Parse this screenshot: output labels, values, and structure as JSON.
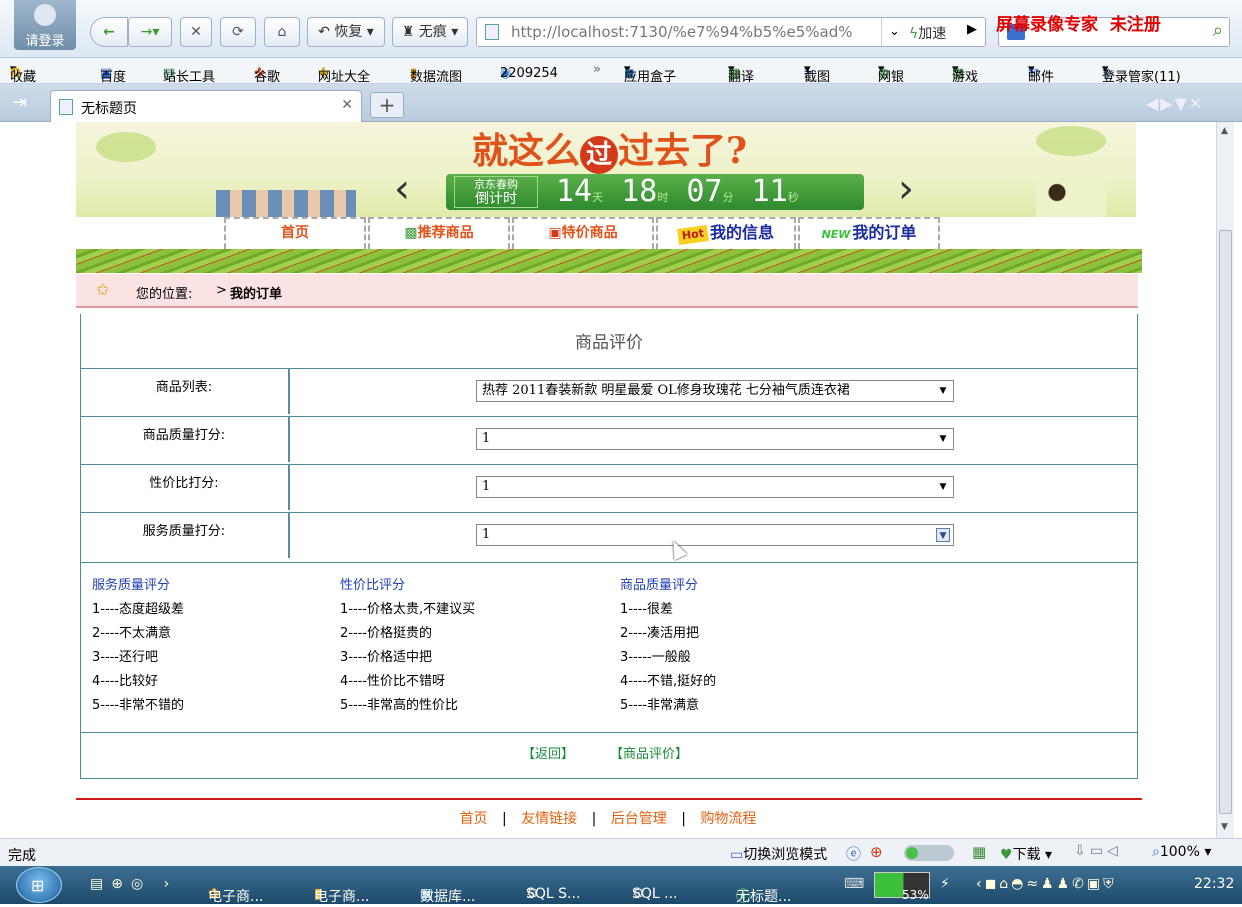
{
  "browser": {
    "login_label": "请登录",
    "restore_label": "恢复",
    "incognito_label": "无痕",
    "url": "http://localhost:7130/%e7%94%b5%e5%ad%",
    "accelerate_label": "加速",
    "watermark": "屏幕录像专家  未注册"
  },
  "bookmarks": [
    "收藏",
    "百度",
    "站长工具",
    "谷歌",
    "网址大全",
    "数据流图",
    "2209254",
    "应用盒子",
    "翻译",
    "截图",
    "网银",
    "游戏",
    "邮件",
    "登录管家(11)"
  ],
  "tab": {
    "title": "无标题页"
  },
  "banner": {
    "slogan": "就这么",
    "slogan_circle": "过",
    "slogan_tail": "过去了?",
    "promo_line1": "京东春购",
    "promo_line2": "倒计时",
    "days": "14",
    "day_unit": "天",
    "hours": "18",
    "hour_unit": "时",
    "minutes": "07",
    "minute_unit": "分",
    "seconds": "11",
    "second_unit": "秒"
  },
  "nav": [
    {
      "label": "首页"
    },
    {
      "label": "推荐商品"
    },
    {
      "label": "特价商品"
    },
    {
      "label": "我的信息",
      "badge": "Hot"
    },
    {
      "label": "我的订单",
      "badge": "NEW"
    }
  ],
  "breadcrumb": {
    "prefix": "您的位置:",
    "sep": ">",
    "current": "我的订单"
  },
  "form": {
    "title": "商品评价",
    "fields": [
      {
        "label": "商品列表:",
        "value": "热荐 2011春装新款 明星最爱 OL修身玫瑰花 七分袖气质连衣裙"
      },
      {
        "label": "商品质量打分:",
        "value": "1"
      },
      {
        "label": "性价比打分:",
        "value": "1"
      },
      {
        "label": "服务质量打分:",
        "value": "1"
      }
    ]
  },
  "legend": {
    "service": {
      "title": "服务质量评分",
      "items": [
        "1----态度超级差",
        "2----不太满意",
        "3----还行吧",
        "4----比较好",
        "5----非常不错的"
      ]
    },
    "value": {
      "title": "性价比评分",
      "items": [
        "1----价格太贵,不建议买",
        "2----价格挺贵的",
        "3----价格适中把",
        "4----性价比不错呀",
        "5----非常高的性价比"
      ]
    },
    "quality": {
      "title": "商品质量评分",
      "items": [
        "1----很差",
        "2----凑活用把",
        "3-----一般般",
        "4----不错,挺好的",
        "5----非常满意"
      ]
    }
  },
  "actions": {
    "back": "【返回】",
    "submit": "【商品评价】"
  },
  "footer": {
    "links": [
      "首页",
      "友情链接",
      "后台管理",
      "购物流程"
    ],
    "sep": "|"
  },
  "status": {
    "text": "完成",
    "mode": "切换浏览模式",
    "download": "下载",
    "zoom": "100%"
  },
  "taskbar": {
    "items": [
      "电子商...",
      "电子商...",
      "数据库...",
      "SQL S...",
      "SQL ...",
      "无标题..."
    ],
    "battery": "53%",
    "time": "22:32"
  }
}
